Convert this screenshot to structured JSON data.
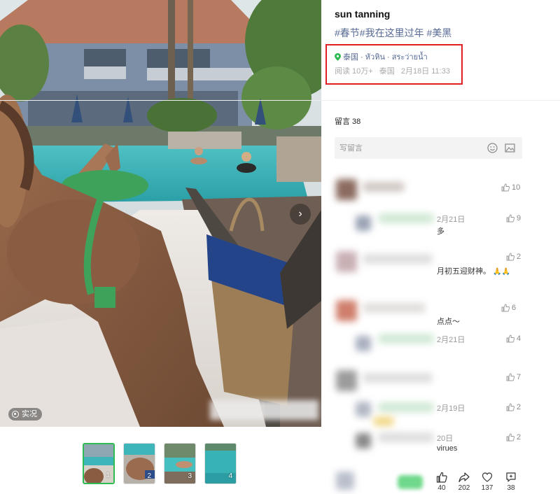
{
  "post": {
    "title": "sun tanning",
    "tags": "#春节#我在这里过年 #美黑",
    "location": "泰国 · หัวหิน · สระว่ายน้ำ",
    "reads": "阅读 10万+",
    "country": "泰国",
    "datetime": "2月18日 11:33"
  },
  "viewer": {
    "live_label": "实况",
    "next_icon": "chevron-right-icon",
    "thumbnails": [
      {
        "num": "1",
        "active": true
      },
      {
        "num": "2",
        "active": false
      },
      {
        "num": "3",
        "active": false
      },
      {
        "num": "4",
        "active": false
      }
    ]
  },
  "comments": {
    "header": "留言 38",
    "input_placeholder": "写留言",
    "items": [
      {
        "text": "",
        "likes": "10"
      },
      {
        "text": "2月21日",
        "likes": "9"
      },
      {
        "text": "多",
        "likes": ""
      },
      {
        "text": "",
        "likes": "2"
      },
      {
        "text": "月初五迎财神。",
        "emoji": "🙏🙏",
        "likes": ""
      },
      {
        "text": "",
        "likes": "6"
      },
      {
        "text": "点点～",
        "likes": ""
      },
      {
        "text": "2月21日",
        "likes": "4"
      },
      {
        "text": "",
        "likes": "7"
      },
      {
        "text": "2月19日",
        "likes": "2"
      },
      {
        "text": "20日",
        "likes": "2"
      },
      {
        "text": "virues",
        "likes": ""
      }
    ]
  },
  "actions": {
    "like_count": "40",
    "share_count": "202",
    "favorite_count": "137",
    "comment_count": "38"
  },
  "colors": {
    "link": "#576b95",
    "highlight_box": "#e02020",
    "active_thumb": "#2dbb52"
  }
}
